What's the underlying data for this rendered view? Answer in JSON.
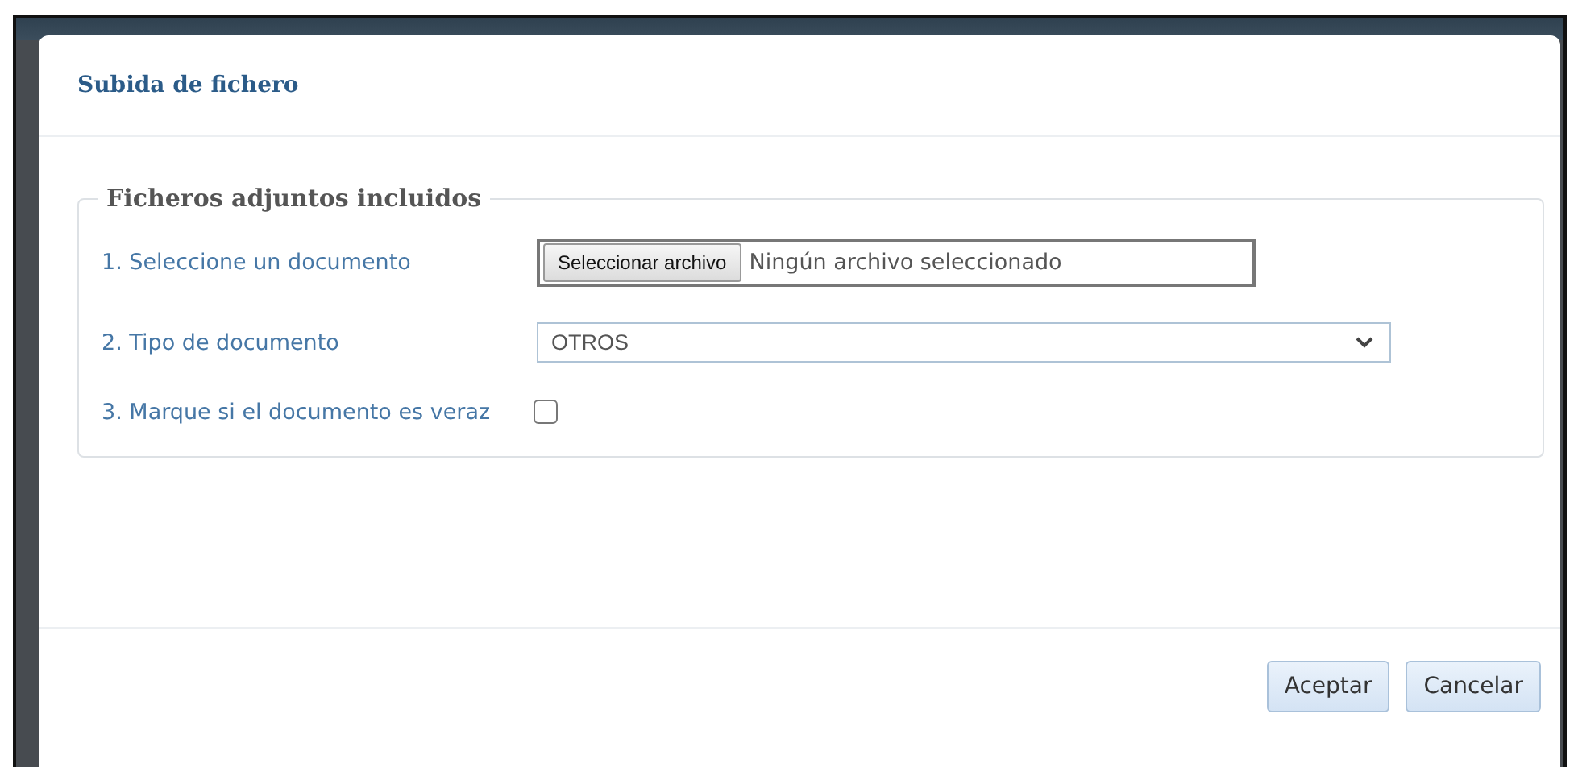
{
  "dialog": {
    "title": "Subida de fichero"
  },
  "fieldset": {
    "legend": "Ficheros adjuntos incluidos"
  },
  "fields": [
    {
      "kind": "file",
      "label": "1. Seleccione un documento",
      "button": "Seleccionar archivo",
      "value": "Ningún archivo seleccionado"
    },
    {
      "kind": "select",
      "label": "2. Tipo de documento",
      "value": "OTROS"
    },
    {
      "kind": "checkbox",
      "label": "3. Marque si el documento es veraz",
      "checked": false
    }
  ],
  "buttons": [
    "Aceptar",
    "Cancelar"
  ]
}
